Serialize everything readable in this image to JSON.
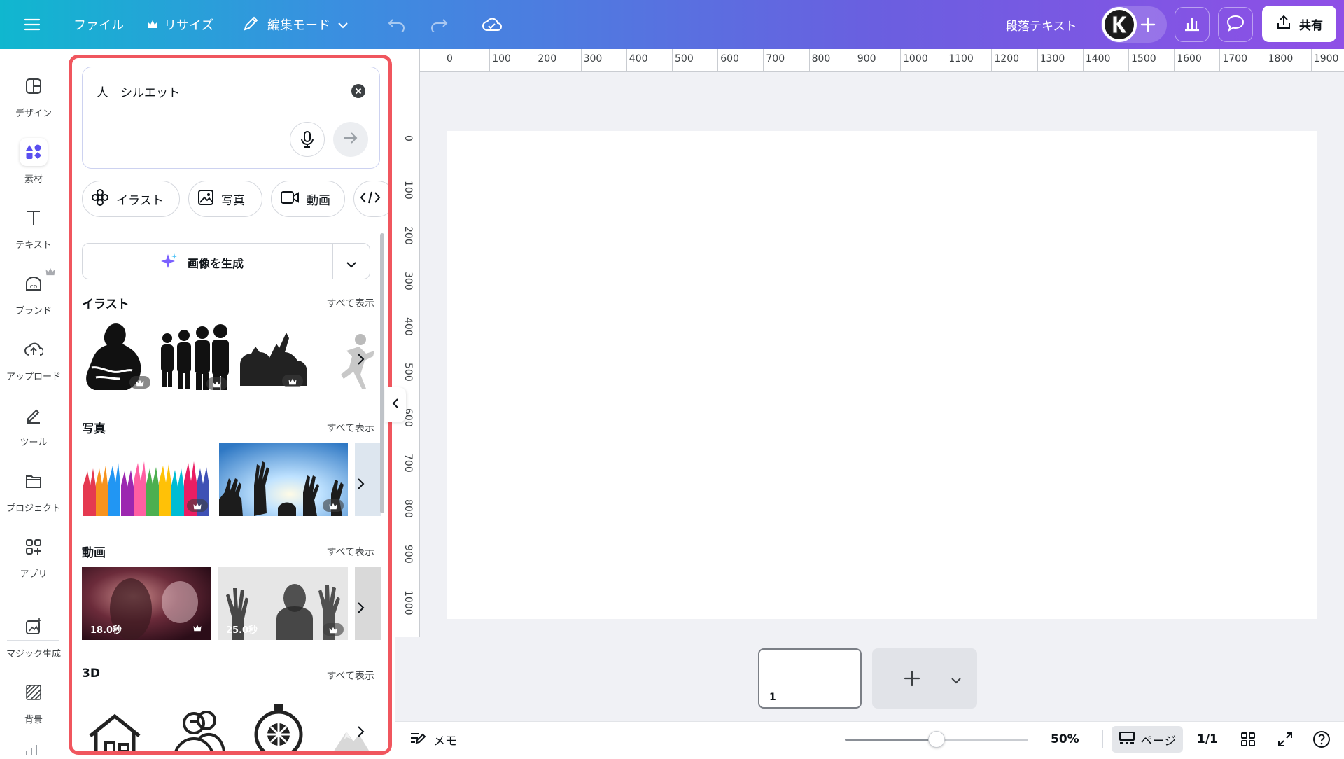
{
  "topbar": {
    "menu_icon": "hamburger-icon",
    "file_label": "ファイル",
    "resize_label": "リサイズ",
    "edit_mode_label": "編集モード",
    "paragraph_text_label": "段落テキスト",
    "share_label": "共有"
  },
  "rail": {
    "items": [
      {
        "label": "デザイン",
        "icon": "design-icon"
      },
      {
        "label": "素材",
        "icon": "elements-icon"
      },
      {
        "label": "テキスト",
        "icon": "text-icon"
      },
      {
        "label": "ブランド",
        "icon": "brand-icon"
      },
      {
        "label": "アップロード",
        "icon": "upload-icon"
      },
      {
        "label": "ツール",
        "icon": "tools-icon"
      },
      {
        "label": "プロジェクト",
        "icon": "projects-icon"
      },
      {
        "label": "アプリ",
        "icon": "apps-icon"
      },
      {
        "label": "マジック生成",
        "icon": "magic-icon"
      },
      {
        "label": "背景",
        "icon": "background-icon"
      }
    ]
  },
  "panel": {
    "search": {
      "value": "人　シルエット"
    },
    "chips": [
      "イラスト",
      "写真",
      "動画"
    ],
    "generate_label": "画像を生成",
    "sections": [
      {
        "title": "イラスト",
        "see_all": "すべて表示"
      },
      {
        "title": "写真",
        "see_all": "すべて表示"
      },
      {
        "title": "動画",
        "see_all": "すべて表示"
      },
      {
        "title": "3D",
        "see_all": "すべて表示"
      }
    ],
    "videos": [
      {
        "duration": "18.0秒"
      },
      {
        "duration": "25.0秒"
      }
    ]
  },
  "ruler": {
    "top": [
      "0",
      "100",
      "200",
      "300",
      "400",
      "500",
      "600",
      "700",
      "800",
      "900",
      "1000",
      "1100",
      "1200",
      "1300",
      "1400",
      "1500",
      "1600",
      "1700",
      "1800",
      "1900"
    ],
    "left": [
      "0",
      "100",
      "200",
      "300",
      "400",
      "500",
      "600",
      "700",
      "800",
      "900",
      "1000"
    ]
  },
  "pages": {
    "thumb_number": "1"
  },
  "bottombar": {
    "notes_label": "メモ",
    "zoom": "50%",
    "zoom_level": 0.5,
    "page_view_label": "ページ",
    "page_count": "1/1"
  },
  "colors": {
    "accent": "#8b3dff",
    "highlight_border": "#f0565e"
  }
}
